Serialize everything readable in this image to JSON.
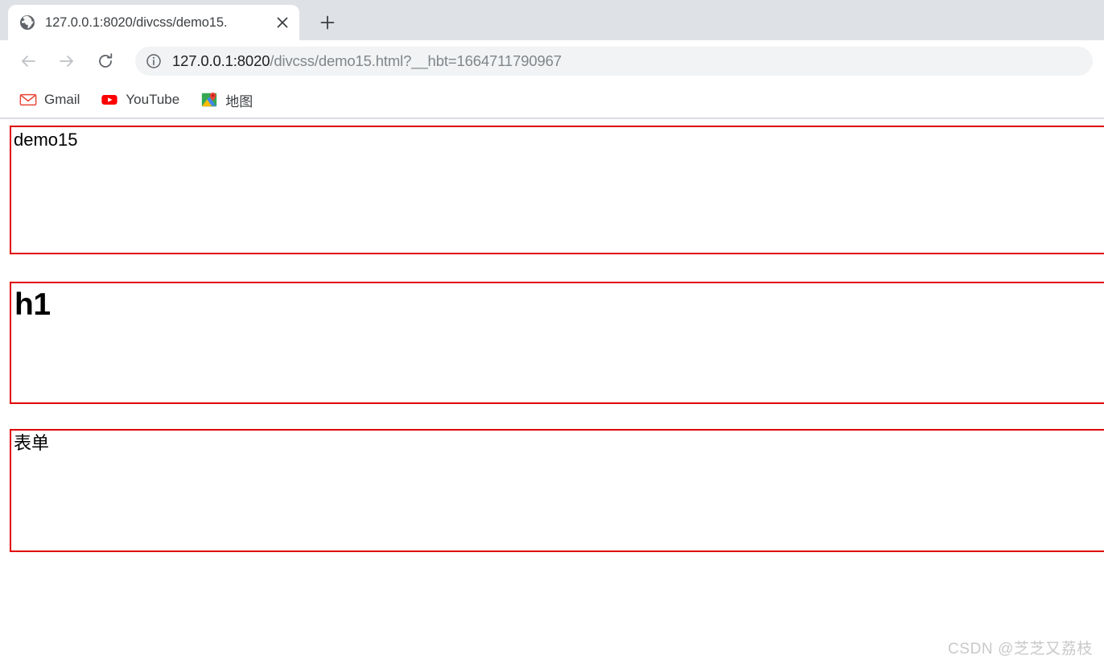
{
  "browser": {
    "tab": {
      "favicon": "globe-icon",
      "title": "127.0.0.1:8020/divcss/demo15.",
      "close_label": "×"
    },
    "new_tab_label": "+",
    "toolbar": {
      "back_label": "←",
      "forward_label": "→",
      "reload_label": "↻",
      "site_info_icon": "info-circle-icon",
      "url_host": "127.0.0.1:8020",
      "url_path": "/divcss/demo15.html?__hbt=1664711790967",
      "url_full": "127.0.0.1:8020/divcss/demo15.html?__hbt=1664711790967"
    },
    "bookmarks": [
      {
        "label": "Gmail",
        "icon": "gmail-icon"
      },
      {
        "label": "YouTube",
        "icon": "youtube-icon"
      },
      {
        "label": "地图",
        "icon": "google-maps-icon"
      }
    ]
  },
  "page": {
    "boxes": [
      {
        "text": "demo15",
        "style": "normal"
      },
      {
        "text": "h1",
        "style": "heading"
      },
      {
        "text": "表单",
        "style": "normal"
      }
    ],
    "border_color": "#e00000",
    "watermark": "CSDN @芝芝又荔枝"
  }
}
